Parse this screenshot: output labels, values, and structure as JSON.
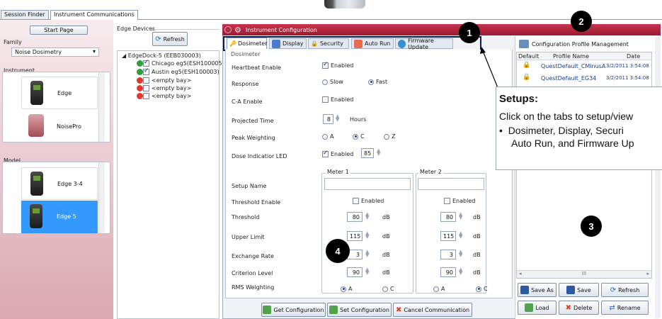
{
  "top_tabs": [
    "Session Finder",
    "Instrument Communications"
  ],
  "left": {
    "start_page": "Start Page",
    "family_label": "Family",
    "family_value": "Noise Dosimetry",
    "instrument_label": "Instrument",
    "instruments": [
      "Edge",
      "NoisePro"
    ],
    "model_label": "Model",
    "models": [
      "Edge 3-4",
      "Edge 5"
    ]
  },
  "edge_devices": {
    "label": "Edge Devices",
    "refresh": "Refresh",
    "root": "EdgeDock-5 (EEB030003)",
    "items": [
      "Chicago eg5(ESH100005)",
      "Austin eg5(ESH100003)",
      "<empty bay>",
      "<empty bay>",
      "<empty bay>"
    ]
  },
  "config": {
    "title": "Instrument Configuration",
    "tabs": [
      "Dosimeter",
      "Display",
      "Security",
      "Auto Run",
      "Firmware Update"
    ],
    "section": "Dosimeter",
    "heartbeat_label": "Heartbeat Enable",
    "heartbeat_value": "Enabled",
    "response_label": "Response",
    "response_slow": "Slow",
    "response_fast": "Fast",
    "ca_label": "C-A Enable",
    "ca_value": "Enabled",
    "projected_label": "Projected Time",
    "projected_value": "8",
    "projected_unit": "Hours",
    "peak_label": "Peak Weighting",
    "peak_a": "A",
    "peak_c": "C",
    "peak_z": "Z",
    "dose_label": "Dose Indicatior LED",
    "dose_enabled": "Enabled",
    "dose_value": "85",
    "meter1": "Meter 1",
    "meter2": "Meter 2",
    "setup_name_label": "Setup Name",
    "threshold_enable_label": "Threshold Enable",
    "threshold_enabled": "Enabled",
    "threshold_label": "Threshold",
    "upper_label": "Upper Limit",
    "exchange_label": "Exchange Rate",
    "criterion_label": "Criterion Level",
    "rms_label": "RMS Weighting",
    "unit_db": "dB",
    "rms_a": "A",
    "rms_c": "C",
    "m1": {
      "threshold": "80",
      "upper": "115",
      "exchange": "3",
      "criterion": "90"
    },
    "m2": {
      "threshold": "80",
      "upper": "115",
      "exchange": "3",
      "criterion": "90"
    },
    "get_config": "Get Configuration",
    "set_config": "Set Configuration",
    "cancel_comm": "Cancel Communication"
  },
  "profiles": {
    "title": "Configuration Profile Management",
    "col_default": "Default",
    "col_name": "Profile Name",
    "col_date": "Date",
    "rows": [
      {
        "name": "QuestDefault_CMinusA",
        "date": "3/2/2011 3:54:08"
      },
      {
        "name": "QuestDefault_EG34",
        "date": "3/2/2011 3:54:08"
      }
    ],
    "scroll_label": "III",
    "save_as": "Save As",
    "save": "Save",
    "refresh": "Refresh",
    "load": "Load",
    "delete": "Delete",
    "rename": "Rename"
  },
  "callouts": [
    "1",
    "2",
    "3",
    "4"
  ],
  "annotation": {
    "heading": "Setups:",
    "line1": "Click on the tabs to setup/view",
    "bullet": "Dosimeter,  Display, Securi",
    "bullet2": "Auto Run, and Firmware Up"
  },
  "colors": {
    "header_red": "#b8203a",
    "selected_blue": "#3399ff",
    "left_panel_bg": "#f2dde1"
  }
}
